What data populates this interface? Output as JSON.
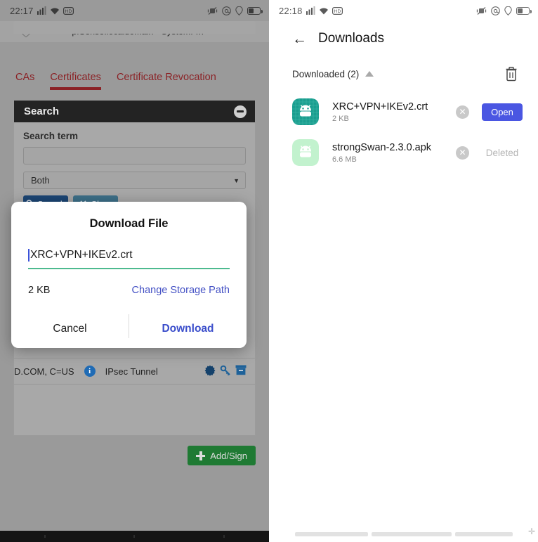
{
  "left_phone": {
    "status_bar": {
      "time": "22:17",
      "icons": [
        "signal-icon",
        "wifi-icon",
        "hd-icon",
        "vibrate-mute-icon",
        "at-icon",
        "location-icon",
        "battery-icon"
      ]
    },
    "browser": {
      "security_icon": "unknown-security-shield-icon",
      "page_title": "pfSense.localdomain - System: …"
    },
    "tabs": [
      {
        "label": "CAs",
        "active": false
      },
      {
        "label": "Certificates",
        "active": true
      },
      {
        "label": "Certificate Revocation",
        "active": false
      }
    ],
    "search_card": {
      "title": "Search",
      "collapse_icon": "minus-circle-icon",
      "field_label": "Search term",
      "term_value": "",
      "scope_select": "Both",
      "caret_icon": "chevron-down-icon",
      "buttons": [
        {
          "label": "Search",
          "icon": "search-icon"
        },
        {
          "label": "Clear",
          "icon": "clear-icon"
        }
      ]
    },
    "cert_row": {
      "distinguished_name": "D.COM, C=US",
      "info_icon": "info-circle-icon",
      "purpose": "IPsec Tunnel",
      "actions": [
        "certificate-badge-icon",
        "key-icon",
        "export-archive-icon"
      ]
    },
    "add_button": {
      "label": "Add/Sign",
      "icon": "plus-icon"
    },
    "nav_bar": "android-navigation-bar"
  },
  "dialog": {
    "title": "Download File",
    "filename_value": "XRC+VPN+IKEv2.crt",
    "file_size": "2 KB",
    "storage_link": "Change Storage Path",
    "cancel_label": "Cancel",
    "download_label": "Download",
    "accent_color": "#3b4ecb",
    "underline_color": "#4dba8f"
  },
  "right_phone": {
    "status_bar": {
      "time": "22:18",
      "icons": [
        "signal-icon",
        "wifi-icon",
        "hd-icon",
        "vibrate-mute-icon",
        "at-icon",
        "location-icon",
        "battery-icon"
      ]
    },
    "header": {
      "back_icon": "back-arrow-icon",
      "title": "Downloads"
    },
    "section": {
      "label": "Downloaded (2)",
      "sort_icon": "triangle-up-icon",
      "delete_icon": "trash-icon"
    },
    "downloads": [
      {
        "icon": "android-apk-icon",
        "icon_color": "#1a9e8f",
        "name": "XRC+VPN+IKEv2.crt",
        "size": "2 KB",
        "dismiss_icon": "close-circle-icon",
        "action_label": "Open",
        "action_state": "active",
        "action_color": "#4a56e2"
      },
      {
        "icon": "android-apk-icon",
        "icon_color": "#b5f0c6",
        "name": "strongSwan-2.3.0.apk",
        "size": "6.6 MB",
        "dismiss_icon": "close-circle-icon",
        "action_label": "Deleted",
        "action_state": "disabled",
        "action_color": "#b4b4b4"
      }
    ],
    "gesture_bar": "three-segment-gesture-bar"
  }
}
